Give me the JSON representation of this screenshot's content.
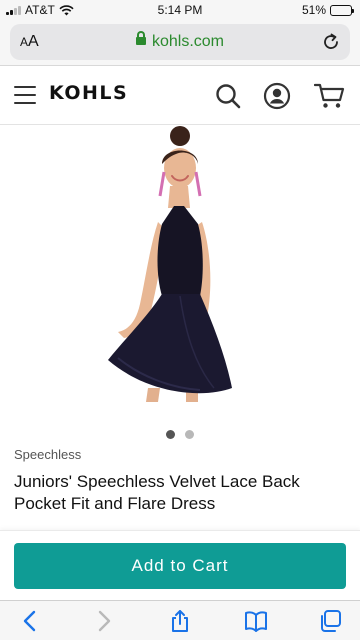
{
  "status_bar": {
    "carrier": "AT&T",
    "time": "5:14 PM",
    "battery_text": "51%",
    "battery_level": 0.51
  },
  "browser": {
    "text_size_label_small": "A",
    "text_size_label_large": "A",
    "url": "kohls.com"
  },
  "site": {
    "logo": "KOHLS"
  },
  "product": {
    "brand": "Speechless",
    "title": "Juniors' Speechless Velvet Lace Back Pocket Fit and Flare Dress",
    "image_count": 2,
    "active_image": 1
  },
  "actions": {
    "add_to_cart": "Add to Cart"
  },
  "colors": {
    "accent": "#0f9c95",
    "secure": "#2b8a2e",
    "toolbar_icon": "#1a73e8"
  },
  "icons": {
    "header": [
      "menu-icon",
      "search-icon",
      "account-icon",
      "cart-icon"
    ],
    "toolbar": [
      "back-icon",
      "forward-icon",
      "share-icon",
      "bookmarks-icon",
      "tabs-icon"
    ]
  }
}
